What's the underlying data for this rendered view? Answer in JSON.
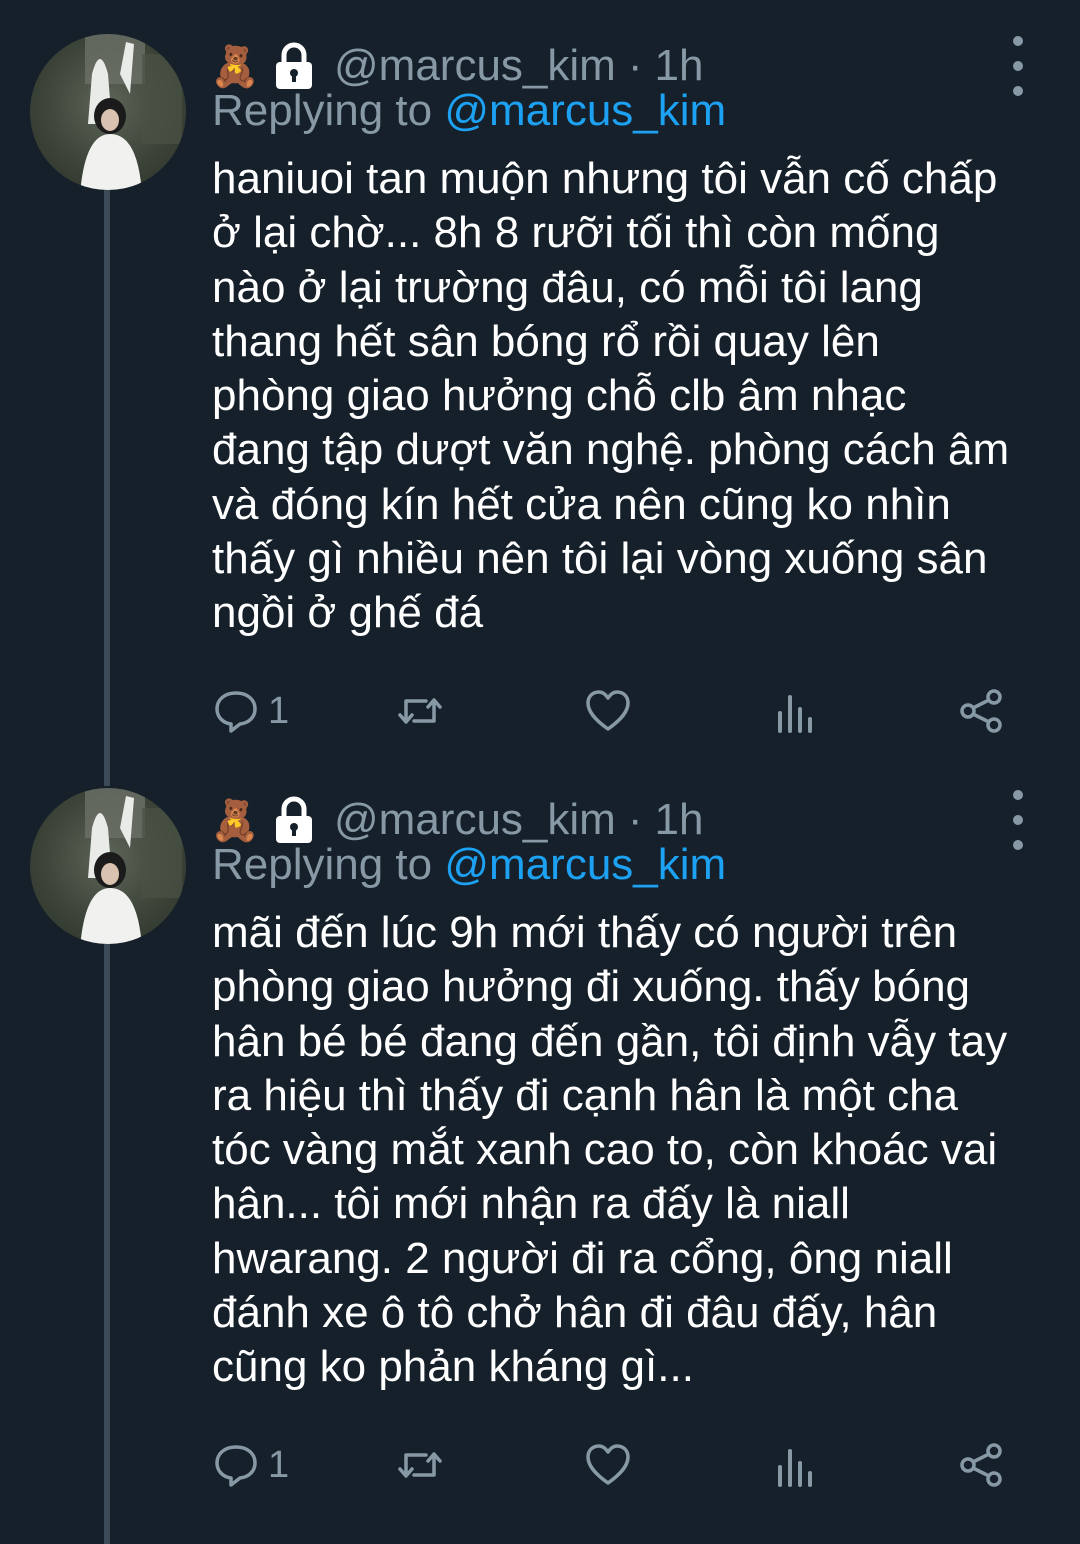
{
  "tweets": [
    {
      "handle": "@marcus_kim",
      "separator": "·",
      "time": "1h",
      "bear_emoji": "🧸",
      "replying_prefix": "Replying to",
      "replying_to": "@marcus_kim",
      "lines": [
        "haniuoi tan muộn nhưng tôi vẫn cố chấp",
        "ở lại chờ... 8h 8 rưỡi tối thì còn mống",
        "nào ở lại trường đâu, có mỗi tôi lang",
        "thang hết sân bóng rổ rồi quay lên",
        "phòng giao hưởng chỗ clb âm nhạc",
        "đang tập dượt văn nghệ. phòng cách âm",
        "và đóng kín hết cửa nên cũng ko nhìn",
        "thấy gì nhiều nên tôi lại vòng xuống sân",
        "ngồi ở ghế đá"
      ],
      "reply_count": "1",
      "retweet_count": "",
      "like_count": ""
    },
    {
      "handle": "@marcus_kim",
      "separator": "·",
      "time": "1h",
      "bear_emoji": "🧸",
      "replying_prefix": "Replying to",
      "replying_to": "@marcus_kim",
      "lines": [
        "mãi đến lúc 9h mới thấy có người trên",
        "phòng giao hưởng đi xuống. thấy bóng",
        "hân bé bé đang đến gần, tôi định vẫy tay",
        "ra hiệu thì thấy đi cạnh hân là một cha",
        "tóc vàng mắt xanh cao to, còn khoác vai",
        "hân... tôi mới nhận ra đấy là niall",
        "hwarang. 2 người đi ra cổng, ông niall",
        "đánh xe ô tô chở hân đi đâu đấy, hân",
        "cũng ko phản kháng gì..."
      ],
      "reply_count": "1",
      "retweet_count": "",
      "like_count": ""
    }
  ],
  "icons": {
    "reply": "speech-bubble-icon",
    "retweet": "retweet-arrows-icon",
    "like": "heart-outline-icon",
    "stats": "bar-chart-icon",
    "share": "share-nodes-icon",
    "lock": "padlock-icon",
    "more": "vertical-dots-icon"
  },
  "colors": {
    "background": "#15202b",
    "muted": "#8899a6",
    "link": "#1da1f2",
    "text": "#ffffff",
    "thread_line": "#3d4a57"
  }
}
